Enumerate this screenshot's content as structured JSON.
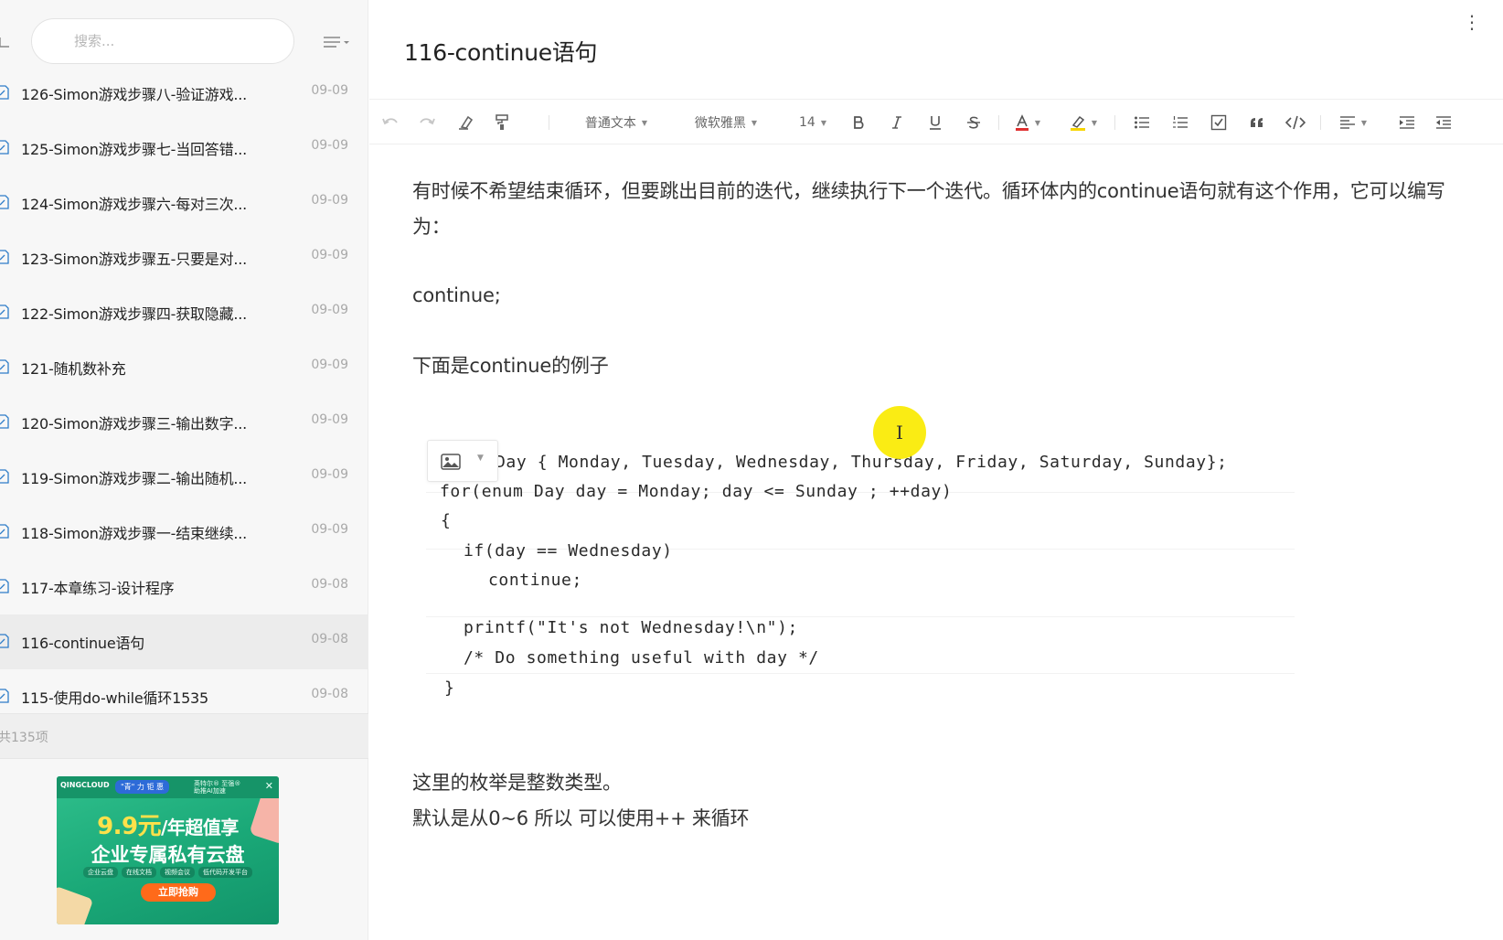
{
  "sidebar": {
    "search_placeholder": "搜索...",
    "notes": [
      {
        "title": "126-Simon游戏步骤八-验证游戏...",
        "date": "09-09",
        "active": false
      },
      {
        "title": "125-Simon游戏步骤七-当回答错...",
        "date": "09-09",
        "active": false
      },
      {
        "title": "124-Simon游戏步骤六-每对三次...",
        "date": "09-09",
        "active": false
      },
      {
        "title": "123-Simon游戏步骤五-只要是对...",
        "date": "09-09",
        "active": false
      },
      {
        "title": "122-Simon游戏步骤四-获取隐藏...",
        "date": "09-09",
        "active": false
      },
      {
        "title": "121-随机数补充",
        "date": "09-09",
        "active": false
      },
      {
        "title": "120-Simon游戏步骤三-输出数字...",
        "date": "09-09",
        "active": false
      },
      {
        "title": "119-Simon游戏步骤二-输出随机...",
        "date": "09-09",
        "active": false
      },
      {
        "title": "118-Simon游戏步骤一-结束继续...",
        "date": "09-09",
        "active": false
      },
      {
        "title": "117-本章练习-设计程序",
        "date": "09-08",
        "active": false
      },
      {
        "title": "116-continue语句",
        "date": "09-08",
        "active": true
      },
      {
        "title": "115-使用do-while循环1535",
        "date": "09-08",
        "active": false
      }
    ],
    "footer_count": "共135项"
  },
  "ad": {
    "brand": "QINGCLOUD",
    "tag": "\"青\" 力 钜 惠",
    "partner": "英特尔® 至强® 助推AI加速",
    "price": "9.9元",
    "price_suffix": "/年超值享",
    "headline": "企业专属私有云盘",
    "features": [
      "企业云盘",
      "在线文档",
      "视频会议",
      "低代码开发平台"
    ],
    "cta": "立即抢购"
  },
  "editor": {
    "title": "116-continue语句",
    "toolbar": {
      "paragraph_style": "普通文本",
      "font_family": "微软雅黑",
      "font_size": "14"
    },
    "paragraphs": {
      "p1_line1": "有时候不希望结束循环，但要跳出目前的迭代，继续执行下一个迭代。循环体内的continue语句就有这个作用，它可以编写",
      "p1_line2": "为：",
      "p2": "continue;",
      "p3": "下面是continue的例子",
      "p4": "这里的枚举是整数类型。",
      "p5": "默认是从0~6  所以 可以使用++ 来循环"
    },
    "code_lines": [
      "Day { Monday, Tuesday, Wednesday, Thursday, Friday, Saturday, Sunday};",
      "for(enum Day day = Monday; day <= Sunday ; ++day)",
      "{",
      "if(day == Wednesday)",
      "continue;",
      "printf(\"It's not Wednesday!\\n\");",
      "/* Do something useful with day */",
      "}"
    ],
    "cursor_glyph": "I"
  }
}
